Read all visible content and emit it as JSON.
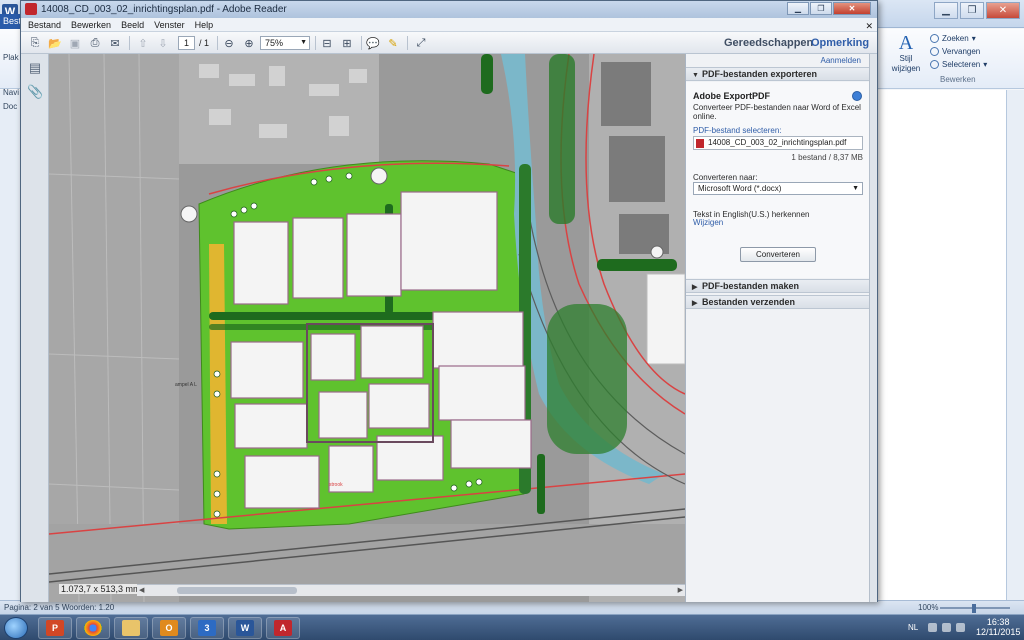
{
  "word": {
    "file_tab": "Best",
    "ribbon_paste": "Plak",
    "nav_pane_label": "Navi",
    "nav_search_placeholder": "Doc",
    "style_button": "Stijl\nwijzigen",
    "style_glyph": "A",
    "find": "Zoeken",
    "replace": "Vervangen",
    "select": "Selecteren",
    "edit_group": "Bewerken",
    "status_left": "Pagina: 2 van 5   Woorden: 1.20",
    "zoom_level": "100%"
  },
  "reader": {
    "title": "14008_CD_003_02_inrichtingsplan.pdf - Adobe Reader",
    "menu": [
      "Bestand",
      "Bewerken",
      "Beeld",
      "Venster",
      "Help"
    ],
    "page_current": "1",
    "page_total": "/ 1",
    "zoom": "75%",
    "tools": "Gereedschappen",
    "comment": "Opmerking",
    "dimensions": "1.073,7 x 513,3 mm"
  },
  "panel": {
    "sign_in": "Aanmelden",
    "export_header": "PDF-bestanden exporteren",
    "export_title": "Adobe ExportPDF",
    "export_desc": "Converteer PDF-bestanden naar Word of Excel online.",
    "select_label": "PDF-bestand selecteren:",
    "file_name": "14008_CD_003_02_inrichtingsplan.pdf",
    "file_count": "1 bestand / 8,37 MB",
    "convert_to_label": "Converteren naar:",
    "convert_to_value": "Microsoft Word (*.docx)",
    "recognize_text": "Tekst in English(U.S.) herkennen",
    "change_link": "Wijzigen",
    "convert_button": "Converteren",
    "create_header": "PDF-bestanden maken",
    "send_header": "Bestanden verzenden"
  },
  "map_labels": [
    "strook",
    "ampel A L"
  ],
  "taskbar": {
    "apps": [
      "powerpoint-icon",
      "chrome-icon",
      "explorer-icon",
      "outlook-icon",
      "onenote-icon",
      "word-icon",
      "acrobat-icon"
    ],
    "lang": "NL",
    "time": "16:38",
    "date": "12/11/2015"
  },
  "colors": {
    "green": "#5fc22e",
    "building": "#f4f4f4",
    "water": "#7bb7c9",
    "road_red": "#d94343",
    "accent_blue": "#2f5da8"
  }
}
